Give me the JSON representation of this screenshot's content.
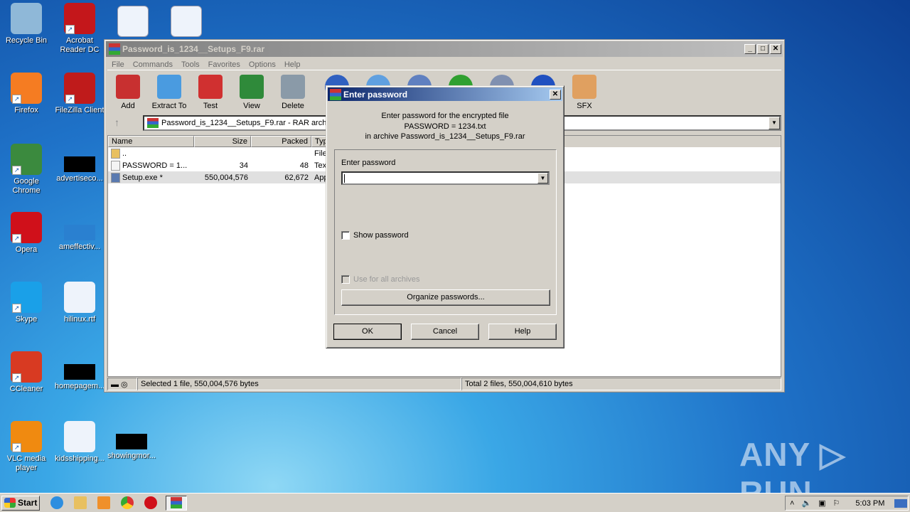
{
  "desktop": {
    "icons": [
      {
        "label": "Recycle Bin",
        "icon": "recycle-bin-icon",
        "color": "#8fb8d8"
      },
      {
        "label": "Acrobat Reader DC",
        "icon": "acrobat-icon",
        "color": "#c4171b"
      },
      {
        "label": "Firefox",
        "icon": "firefox-icon",
        "color": "#f57c22"
      },
      {
        "label": "FileZilla Client",
        "icon": "filezilla-icon",
        "color": "#bf1b1b"
      },
      {
        "label": "Google Chrome",
        "icon": "chrome-icon",
        "color": "#3b8a3e"
      },
      {
        "label": "advertiseco...",
        "icon": "file-icon",
        "color": "#000000"
      },
      {
        "label": "Opera",
        "icon": "opera-icon",
        "color": "#d0101a"
      },
      {
        "label": "ameffectiv...",
        "icon": "file-icon",
        "color": "#2a80d0"
      },
      {
        "label": "Skype",
        "icon": "skype-icon",
        "color": "#1aa0e8"
      },
      {
        "label": "hilinux.rtf",
        "icon": "word-doc-icon",
        "color": "#eef3fb"
      },
      {
        "label": "CCleaner",
        "icon": "ccleaner-icon",
        "color": "#d83a22"
      },
      {
        "label": "homepagem...",
        "icon": "file-icon",
        "color": "#000000"
      },
      {
        "label": "VLC media player",
        "icon": "vlc-icon",
        "color": "#f08a10"
      },
      {
        "label": "kidsshipping...",
        "icon": "word-doc-icon",
        "color": "#eef3fb"
      },
      {
        "label": "showingmor...",
        "icon": "file-icon",
        "color": "#000000"
      }
    ]
  },
  "winrar": {
    "title": "Password_is_1234__Setups_F9.rar",
    "menu": [
      "File",
      "Commands",
      "Tools",
      "Favorites",
      "Options",
      "Help"
    ],
    "toolbar": [
      {
        "label": "Add",
        "icon": "add-archive-icon",
        "color": "#c83030"
      },
      {
        "label": "Extract To",
        "icon": "extract-folder-icon",
        "color": "#4a9be0"
      },
      {
        "label": "Test",
        "icon": "test-clipboard-icon",
        "color": "#d03030"
      },
      {
        "label": "View",
        "icon": "view-book-icon",
        "color": "#2f8a3a"
      },
      {
        "label": "Delete",
        "icon": "delete-trash-icon",
        "color": "#8a9aa8"
      },
      {
        "label": "",
        "icon": "find-icon",
        "color": "#3060c0"
      },
      {
        "label": "",
        "icon": "wizard-icon",
        "color": "#60a0e0"
      },
      {
        "label": "",
        "icon": "info-icon",
        "color": "#6080c0"
      },
      {
        "label": "",
        "icon": "virus-scan-icon",
        "color": "#30a030"
      },
      {
        "label": "",
        "icon": "comment-icon",
        "color": "#8090b0"
      },
      {
        "label": "",
        "icon": "protect-icon",
        "color": "#2050c0"
      },
      {
        "label": "SFX",
        "icon": "sfx-box-icon",
        "color": "#e0a060"
      }
    ],
    "address": "Password_is_1234__Setups_F9.rar - RAR archiv",
    "columns": [
      "Name",
      "Size",
      "Packed",
      "Type"
    ],
    "files": [
      {
        "name": "..",
        "size": "",
        "packed": "",
        "type": "File f",
        "icon": "folder-icon"
      },
      {
        "name": "PASSWORD = 1...",
        "size": "34",
        "packed": "48",
        "type": "Text",
        "icon": "text-file-icon"
      },
      {
        "name": "Setup.exe *",
        "size": "550,004,576",
        "packed": "62,672",
        "type": "Appl",
        "icon": "exe-file-icon",
        "selected": true
      }
    ],
    "status_left": "Selected 1 file, 550,004,576 bytes",
    "status_right": "Total 2 files, 550,004,610 bytes"
  },
  "dialog": {
    "title": "Enter password",
    "line1": "Enter password for the encrypted file",
    "line2": "PASSWORD =  1234.txt",
    "line3": "in archive Password_is_1234__Setups_F9.rar",
    "field_label": "Enter password",
    "password_value": "",
    "show_password": "Show password",
    "show_password_checked": false,
    "use_all": "Use for all archives",
    "use_all_enabled": false,
    "organize": "Organize passwords...",
    "ok": "OK",
    "cancel": "Cancel",
    "help": "Help"
  },
  "taskbar": {
    "start": "Start",
    "clock": "5:03 PM"
  },
  "watermark": "ANY ▷ RUN"
}
